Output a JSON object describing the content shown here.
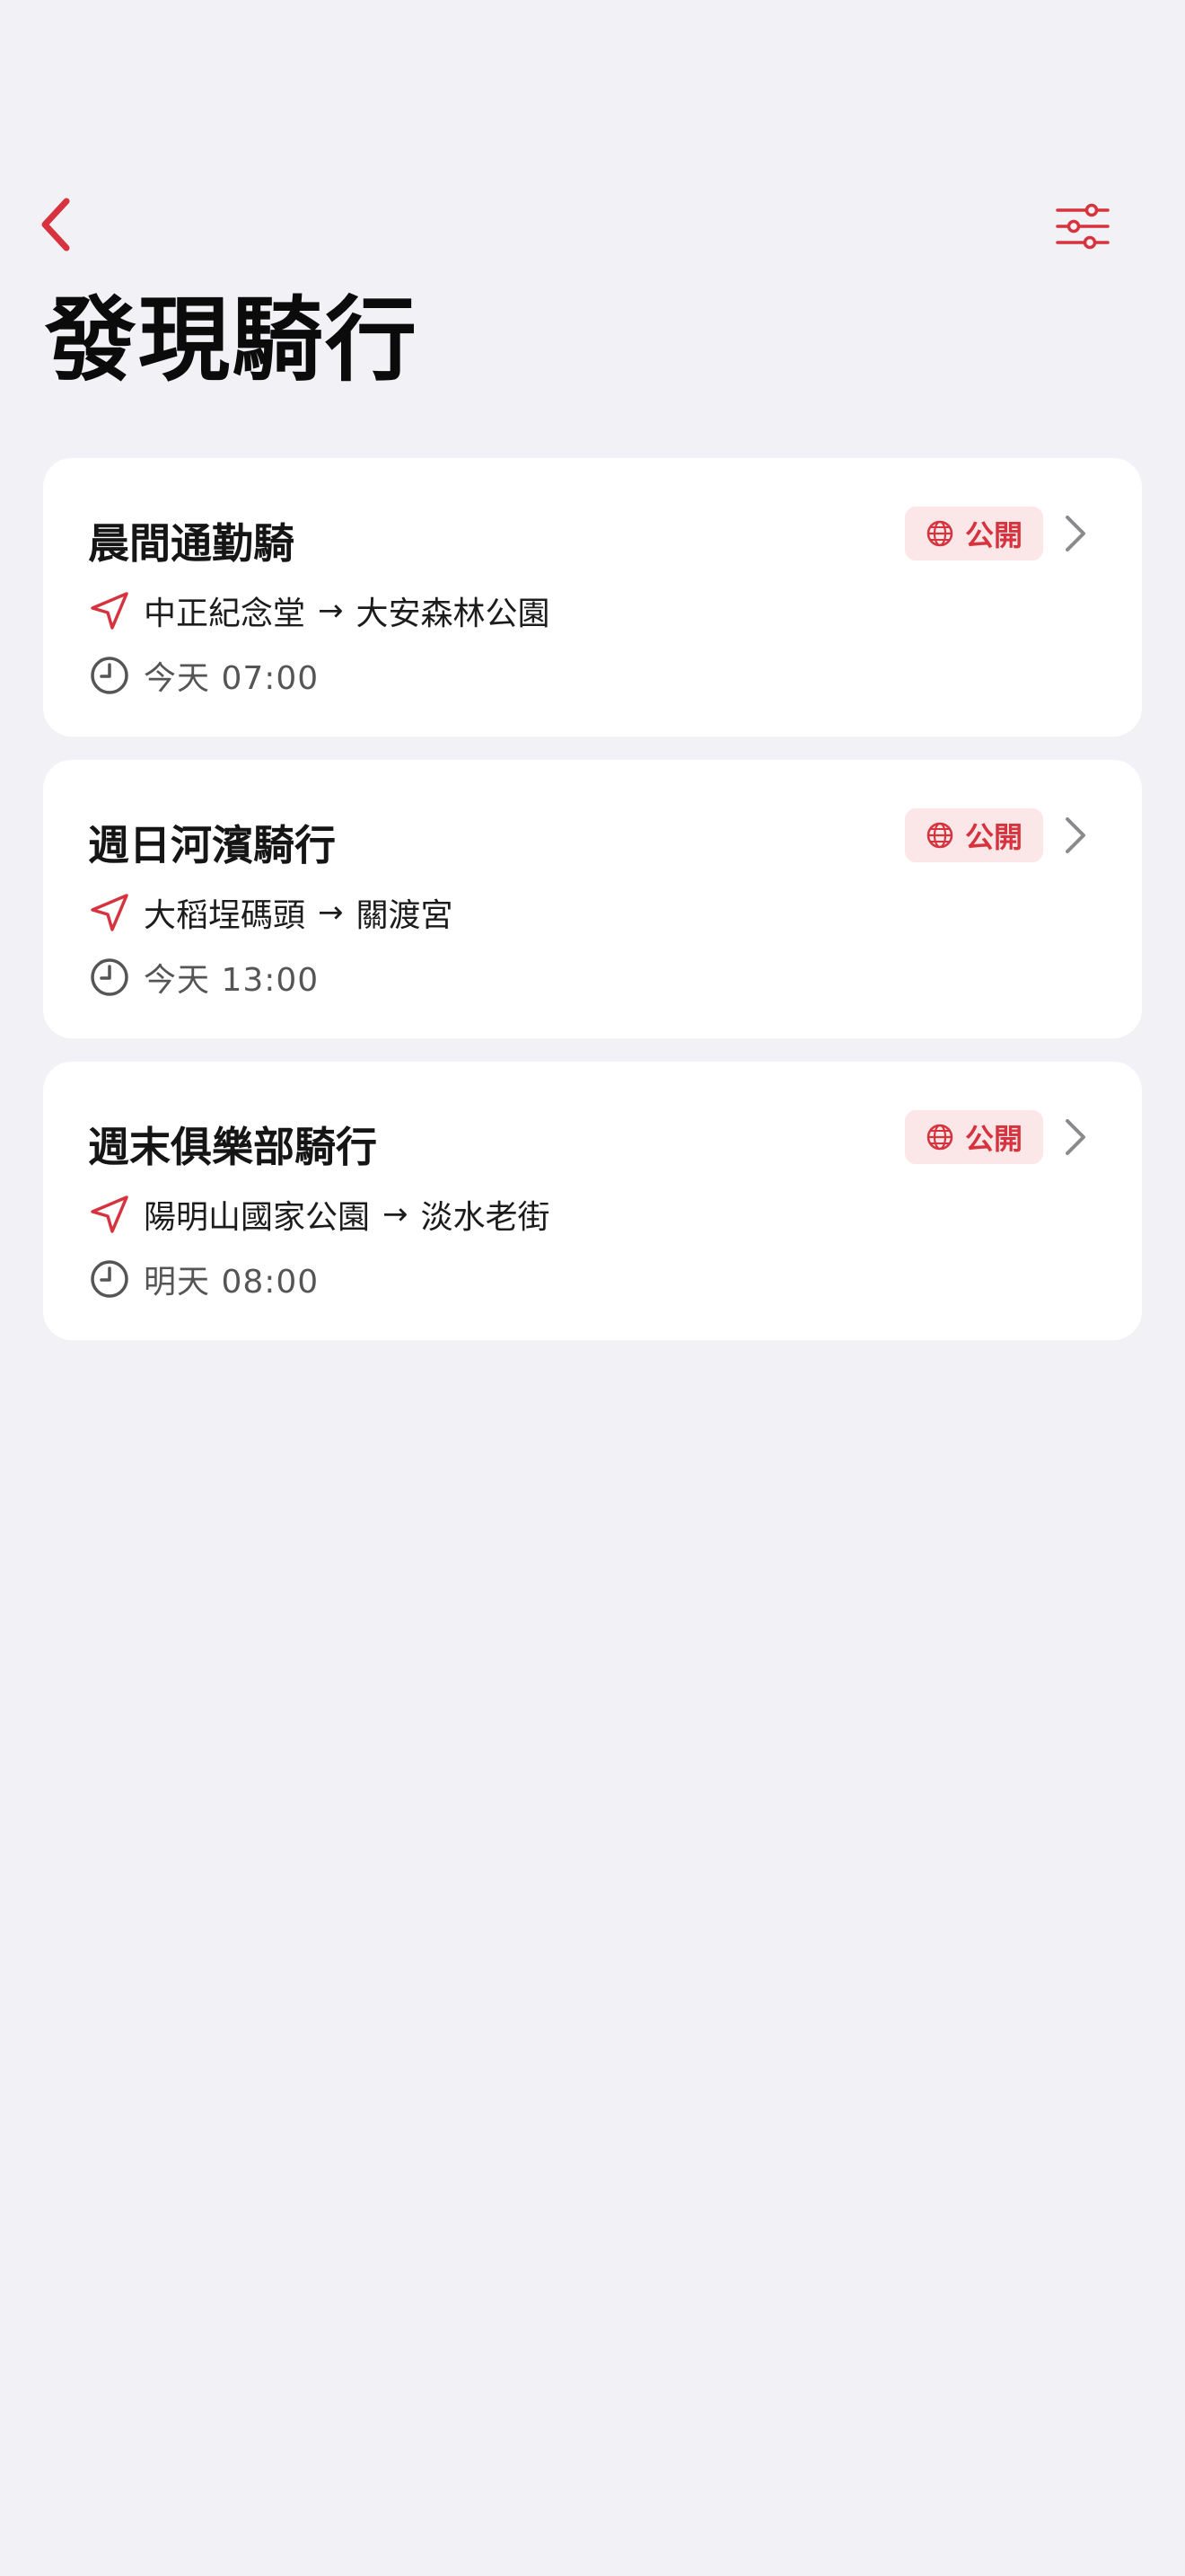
{
  "page": {
    "title": "發現騎行"
  },
  "nav": {
    "back_icon": "chevron-left-icon",
    "filter_icon": "sliders-icon"
  },
  "colors": {
    "accent": "#d6333e",
    "background": "#f2f1f6",
    "card": "#ffffff",
    "badge_bg": "#fbe6e8"
  },
  "rides": [
    {
      "title": "晨間通勤騎",
      "badge": "公開",
      "from": "中正紀念堂",
      "to": "大安森林公園",
      "arrow": "→",
      "time": "今天 07:00"
    },
    {
      "title": "週日河濱騎行",
      "badge": "公開",
      "from": "大稻埕碼頭",
      "to": "關渡宮",
      "arrow": "→",
      "time": "今天 13:00"
    },
    {
      "title": "週末俱樂部騎行",
      "badge": "公開",
      "from": "陽明山國家公園",
      "to": "淡水老街",
      "arrow": "→",
      "time": "明天 08:00"
    }
  ]
}
